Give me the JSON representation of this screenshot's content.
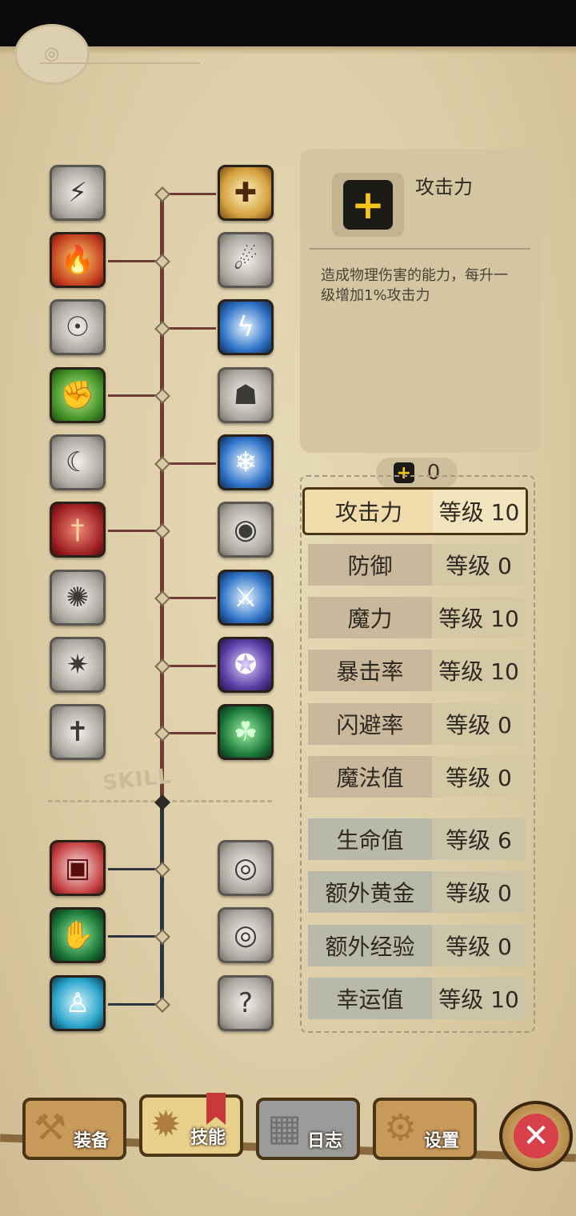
{
  "info": {
    "title": "攻击力",
    "description": "造成物理伤害的能力，每升一级增加1%攻击力"
  },
  "points": {
    "available": "0"
  },
  "skill_tree": {
    "watermark": "SKILL",
    "left_icons": [
      "claw-slash-icon",
      "flame-strike-icon",
      "roar-icon",
      "muscle-arm-icon",
      "crescent-slash-icon",
      "dagger-icon",
      "spin-attack-icon",
      "thunder-beast-icon",
      "cross-blade-icon",
      "red-chest-icon",
      "green-chest-icon",
      "blue-aura-icon"
    ],
    "right_icons": [
      "holy-shield-icon",
      "lightning-figure-icon",
      "lightning-strike-icon",
      "hood-figure-icon",
      "frost-burst-icon",
      "eye-burst-icon",
      "sword-wind-icon",
      "dark-orb-icon",
      "clover-figure-icon",
      "eye-chest-icon",
      "eye-chest-icon-2",
      "mystery-figure-icon"
    ]
  },
  "stats": [
    {
      "name": "攻击力",
      "level": "等级 10"
    },
    {
      "name": "防御",
      "level": "等级 0"
    },
    {
      "name": "魔力",
      "level": "等级 10"
    },
    {
      "name": "暴击率",
      "level": "等级 10"
    },
    {
      "name": "闪避率",
      "level": "等级 0"
    },
    {
      "name": "魔法值",
      "level": "等级 0"
    },
    {
      "name": "生命值",
      "level": "等级 6"
    },
    {
      "name": "额外黄金",
      "level": "等级 0"
    },
    {
      "name": "额外经验",
      "level": "等级 0"
    },
    {
      "name": "幸运值",
      "level": "等级 10"
    }
  ],
  "nav": {
    "equip": "装备",
    "skills": "技能",
    "log": "日志",
    "settings": "设置"
  },
  "colors": {
    "accent_gold": "#f6c518",
    "close_red": "#d8404a"
  }
}
